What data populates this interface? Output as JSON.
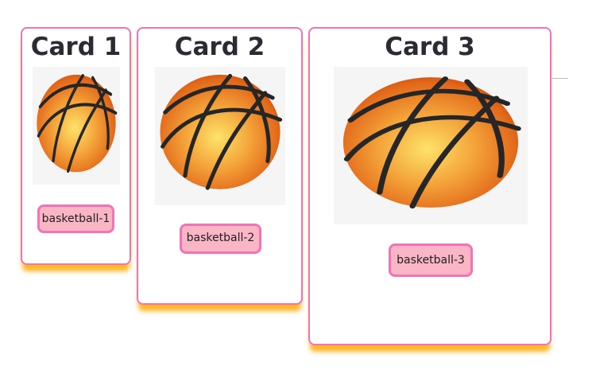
{
  "cards": [
    {
      "title": "Card 1",
      "tag": "basketball-1"
    },
    {
      "title": "Card 2",
      "tag": "basketball-2"
    },
    {
      "title": "Card 3",
      "tag": "basketball-3"
    }
  ],
  "colors": {
    "card_border": "#f472b6",
    "card_shadow": "#ffaa00",
    "tag_background": "#fbb6c6",
    "tag_border": "#f472b6",
    "ball_center": "#fde36a",
    "ball_edge": "#d95a0e",
    "ball_seam": "#262626"
  },
  "icons": {
    "card_image": "basketball-icon"
  }
}
